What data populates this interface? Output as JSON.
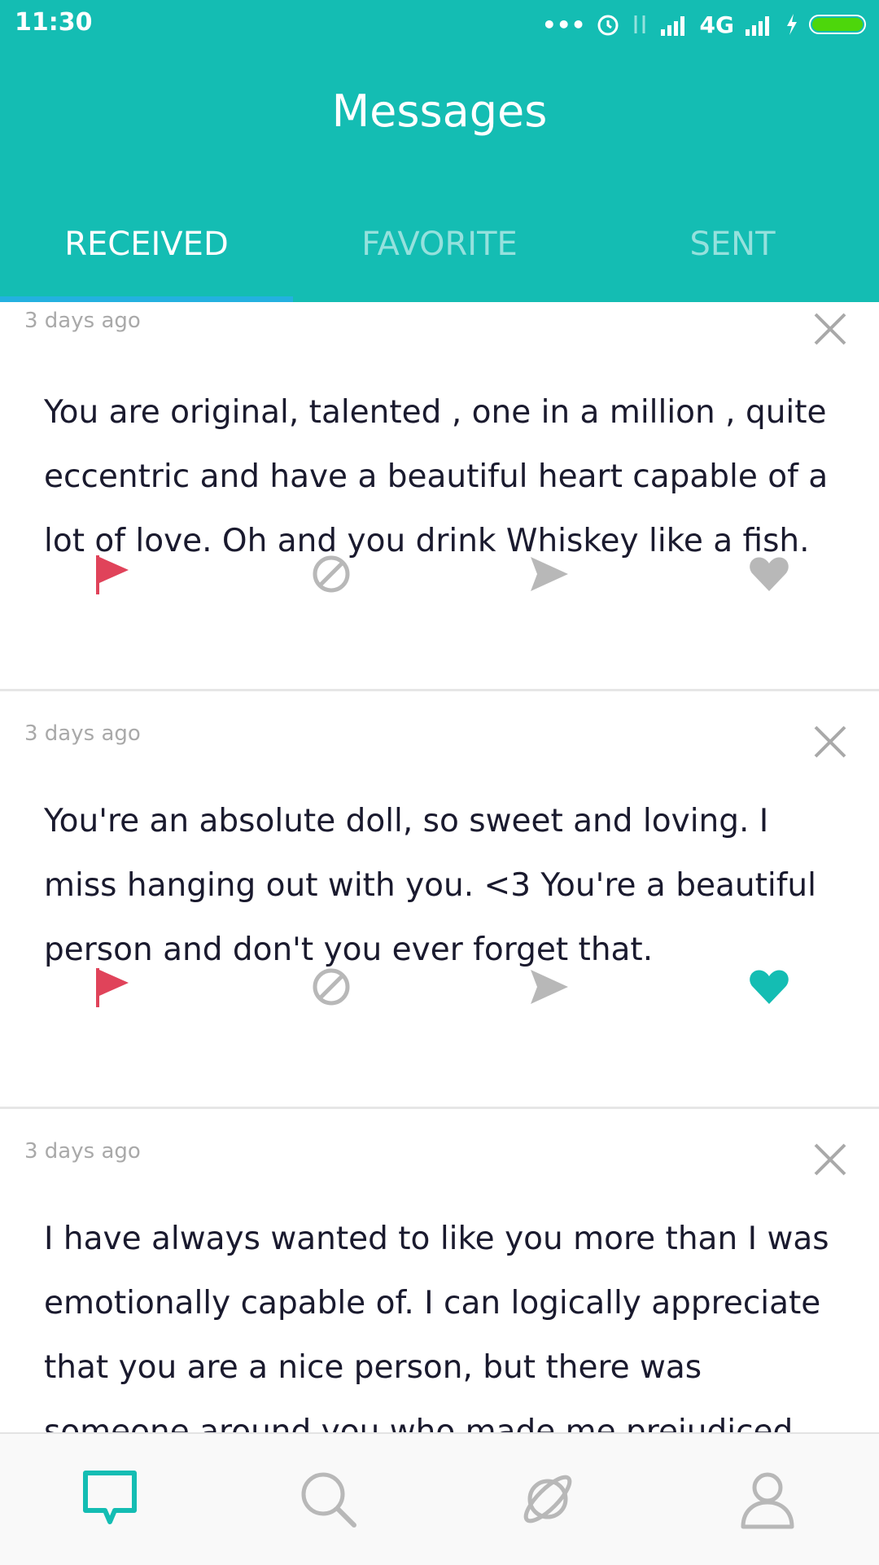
{
  "status_bar": {
    "time": "11:30",
    "network": "4G",
    "dots": "•••"
  },
  "header": {
    "title": "Messages"
  },
  "tabs": [
    {
      "label": "RECEIVED",
      "active": true
    },
    {
      "label": "FAVORITE",
      "active": false
    },
    {
      "label": "SENT",
      "active": false
    }
  ],
  "messages": [
    {
      "time_ago": "3 days ago",
      "text": "You are original, talented , one in a million , quite eccentric and have a beautiful heart capable of a lot of love. Oh and you drink Whiskey like a fish.",
      "favorited": false
    },
    {
      "time_ago": "3 days ago",
      "text": "You're an absolute doll, so sweet and loving. I miss hanging out with you. <3 You're a beautiful person and don't you ever forget that.",
      "favorited": true
    },
    {
      "time_ago": "3 days ago",
      "text": "I have always wanted to like you more than I was emotionally capable of. I can logically appreciate that you are a nice person, but there was someone around you who made me prejudiced. Thank God that",
      "favorited": false
    }
  ],
  "colors": {
    "accent": "#14bdb3",
    "flag": "#e0435a",
    "icon_gray": "#b8b8b8",
    "text": "#1a1a2e"
  },
  "bottom_nav": [
    "chat-icon",
    "search-icon",
    "planet-icon",
    "profile-icon"
  ]
}
